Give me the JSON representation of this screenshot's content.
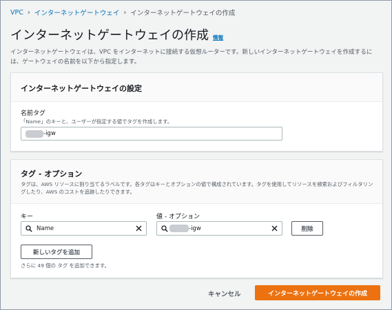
{
  "breadcrumb": {
    "items": [
      "VPC",
      "インターネットゲートウェイ",
      "インターネットゲートウェイの作成"
    ]
  },
  "page": {
    "title": "インターネットゲートウェイの作成",
    "info_link": "情報",
    "description": "インターネットゲートウェイは、VPC をインターネットに接続する仮想ルーターです。新しいインターネットゲートウェイを作成するには、ゲートウェイの名前を以下から指定します。"
  },
  "settings_panel": {
    "title": "インターネットゲートウェイの設定",
    "name_tag_label": "名前タグ",
    "name_tag_hint": "「Name」のキーと、ユーザーが指定する値でタグを作成します。",
    "name_tag_value_suffix": "-igw"
  },
  "tags_panel": {
    "title": "タグ - オプション",
    "description": "タグは、AWS リソースに割り当てるラベルです。各タグはキーとオプションの値で構成されています。タグを使用してリソースを検索およびフィルタリングしたり、AWS のコストを追跡したりできます。",
    "key_label": "キー",
    "value_label": "値 - オプション",
    "rows": [
      {
        "key": "Name",
        "value_suffix": "-igw",
        "remove_label": "削除"
      }
    ],
    "add_tag_label": "新しいタグを追加",
    "limit_hint": "さらに 49 個の タグ を追加できます。"
  },
  "footer": {
    "cancel_label": "キャンセル",
    "submit_label": "インターネットゲートウェイの作成"
  },
  "colors": {
    "primary": "#ec7211",
    "link": "#0073bb",
    "background": "#f2f3f3"
  },
  "icons": {
    "breadcrumb_separator": "chevron-right-icon",
    "search": "search-icon",
    "clear": "close-icon"
  }
}
